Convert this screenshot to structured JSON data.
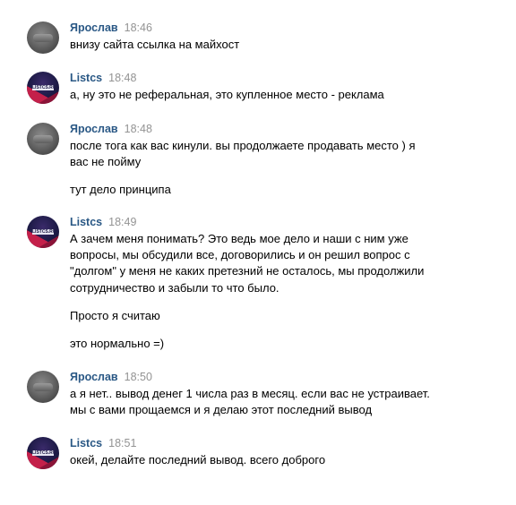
{
  "top_partial_text": " ",
  "messages": [
    {
      "author": "Ярослав",
      "time": "18:46",
      "avatar": "gray",
      "lines": [
        "внизу сайта ссылка на майхост"
      ]
    },
    {
      "author": "Listcs",
      "time": "18:48",
      "avatar": "brand",
      "lines": [
        "а, ну это не реферальная, это купленное место - реклама"
      ]
    },
    {
      "author": "Ярослав",
      "time": "18:48",
      "avatar": "gray",
      "lines": [
        "после тога как вас кинули. вы продолжаете продавать место ) я",
        "вас не пойму",
        "тут дело принципа"
      ]
    },
    {
      "author": "Listcs",
      "time": "18:49",
      "avatar": "brand",
      "lines": [
        "А зачем меня понимать? Это ведь мое дело и наши с ним уже",
        "вопросы, мы обсудили все, договорились и он решил вопрос с",
        "\"долгом\" у меня не каких претезний не осталось, мы продолжили",
        "сотрудничество и забыли то что было.",
        "Просто я считаю",
        "это нормально =)"
      ]
    },
    {
      "author": "Ярослав",
      "time": "18:50",
      "avatar": "gray",
      "lines": [
        "а я нет.. вывод денег 1 числа раз в месяц. если вас не устраивает.",
        "мы с вами прощаемся и я делаю этот последний вывод"
      ]
    },
    {
      "author": "Listcs",
      "time": "18:51",
      "avatar": "brand",
      "lines": [
        "окей, делайте последний вывод. всего доброго"
      ]
    }
  ]
}
